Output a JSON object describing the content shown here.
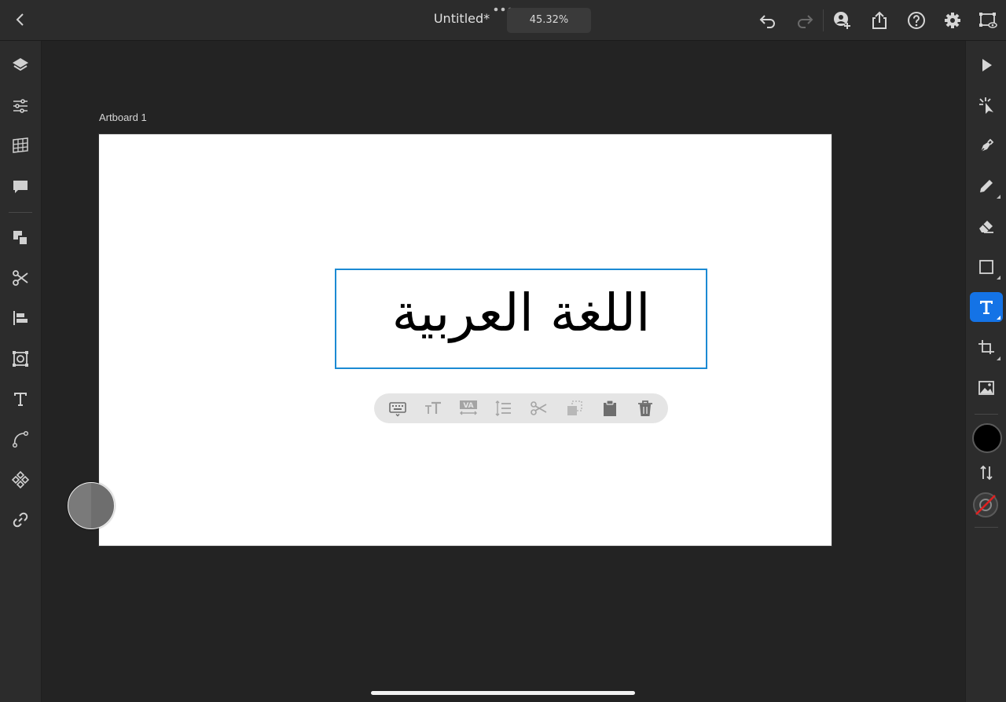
{
  "header": {
    "title": "Untitled*",
    "zoom": "45.32%"
  },
  "canvas": {
    "artboard_label": "Artboard 1",
    "text_content": "اللغة العربية"
  },
  "left_toolbar": [
    "layers-icon",
    "properties-icon",
    "grid-icon",
    "comment-icon",
    "arrange-icon",
    "cut-icon",
    "align-icon",
    "repeat-grid-icon",
    "type-icon",
    "path-icon",
    "components-icon",
    "link-icon"
  ],
  "right_toolbar": [
    "select-tool",
    "direct-select-tool",
    "pen-tool",
    "pencil-tool",
    "eraser-tool",
    "shape-tool",
    "type-tool",
    "crop-tool",
    "image-tool"
  ],
  "colors": {
    "accent": "#1473e6",
    "selection": "#1b8ad3",
    "fill": "#000000",
    "canvas_bg": "#232323",
    "toolbar_bg": "#2c2c2c"
  }
}
